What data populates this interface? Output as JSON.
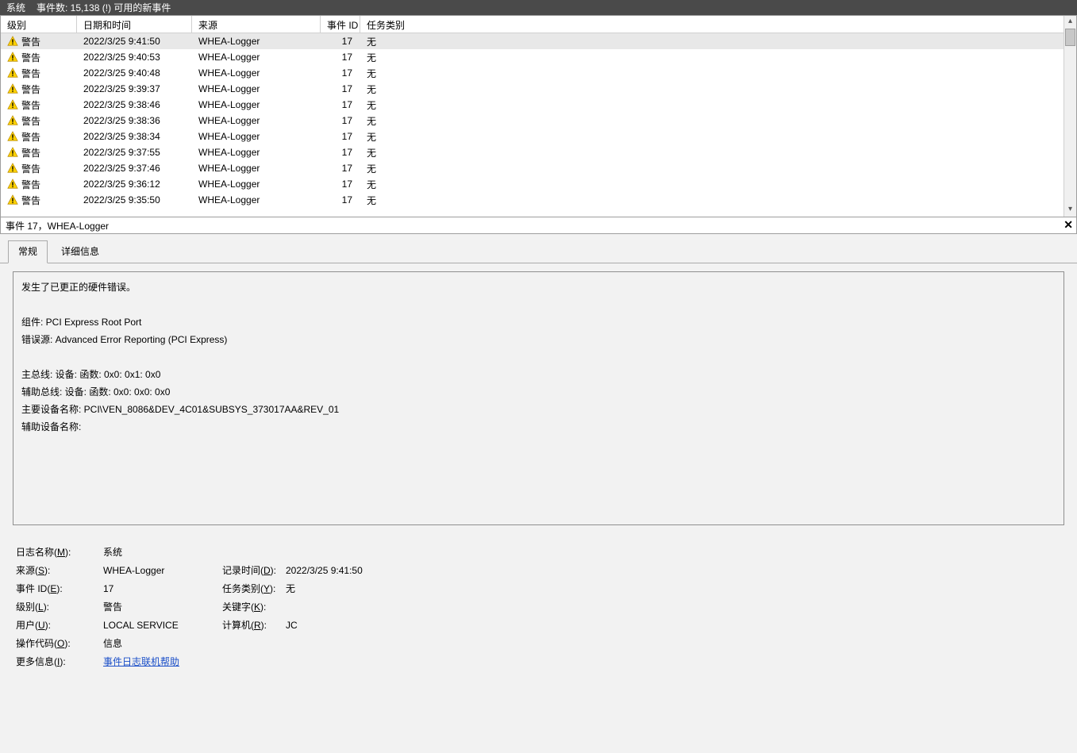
{
  "titleBar": {
    "app": "系统",
    "count": "事件数: 15,138 (!) 可用的新事件"
  },
  "headers": {
    "level": "级别",
    "datetime": "日期和时间",
    "source": "来源",
    "eventId": "事件 ID",
    "category": "任务类别"
  },
  "rows": [
    {
      "level": "警告",
      "dt": "2022/3/25 9:41:50",
      "src": "WHEA-Logger",
      "eid": "17",
      "cat": "无",
      "sel": true
    },
    {
      "level": "警告",
      "dt": "2022/3/25 9:40:53",
      "src": "WHEA-Logger",
      "eid": "17",
      "cat": "无"
    },
    {
      "level": "警告",
      "dt": "2022/3/25 9:40:48",
      "src": "WHEA-Logger",
      "eid": "17",
      "cat": "无"
    },
    {
      "level": "警告",
      "dt": "2022/3/25 9:39:37",
      "src": "WHEA-Logger",
      "eid": "17",
      "cat": "无"
    },
    {
      "level": "警告",
      "dt": "2022/3/25 9:38:46",
      "src": "WHEA-Logger",
      "eid": "17",
      "cat": "无"
    },
    {
      "level": "警告",
      "dt": "2022/3/25 9:38:36",
      "src": "WHEA-Logger",
      "eid": "17",
      "cat": "无"
    },
    {
      "level": "警告",
      "dt": "2022/3/25 9:38:34",
      "src": "WHEA-Logger",
      "eid": "17",
      "cat": "无"
    },
    {
      "level": "警告",
      "dt": "2022/3/25 9:37:55",
      "src": "WHEA-Logger",
      "eid": "17",
      "cat": "无"
    },
    {
      "level": "警告",
      "dt": "2022/3/25 9:37:46",
      "src": "WHEA-Logger",
      "eid": "17",
      "cat": "无"
    },
    {
      "level": "警告",
      "dt": "2022/3/25 9:36:12",
      "src": "WHEA-Logger",
      "eid": "17",
      "cat": "无"
    },
    {
      "level": "警告",
      "dt": "2022/3/25 9:35:50",
      "src": "WHEA-Logger",
      "eid": "17",
      "cat": "无"
    }
  ],
  "detailTitle": "事件 17，WHEA-Logger",
  "tabs": {
    "general": "常规",
    "details": "详细信息"
  },
  "desc": {
    "l1": "发生了已更正的硬件错误。",
    "blank": "",
    "l2": "组件: PCI Express Root Port",
    "l3": "错误源: Advanced Error Reporting (PCI Express)",
    "l4": "主总线: 设备: 函数: 0x0: 0x1: 0x0",
    "l5": "辅助总线: 设备: 函数: 0x0: 0x0: 0x0",
    "l6": "主要设备名称: PCI\\VEN_8086&DEV_4C01&SUBSYS_373017AA&REV_01",
    "l7": "辅助设备名称:"
  },
  "props": {
    "logNameL": "日志名称(M):",
    "logNameV": "系统",
    "sourceL": "来源(S):",
    "sourceV": "WHEA-Logger",
    "loggedL": "记录时间(D):",
    "loggedV": "2022/3/25 9:41:50",
    "eventIdL": "事件 ID(E):",
    "eventIdV": "17",
    "taskCatL": "任务类别(Y):",
    "taskCatV": "无",
    "levelL": "级别(L):",
    "levelV": "警告",
    "keywordsL": "关键字(K):",
    "keywordsV": "",
    "userL": "用户(U):",
    "userV": "LOCAL SERVICE",
    "computerL": "计算机(R):",
    "computerV": "JC",
    "opcodeL": "操作代码(O):",
    "opcodeV": "信息",
    "moreInfoL": "更多信息(I):",
    "moreInfoV": "事件日志联机帮助"
  }
}
